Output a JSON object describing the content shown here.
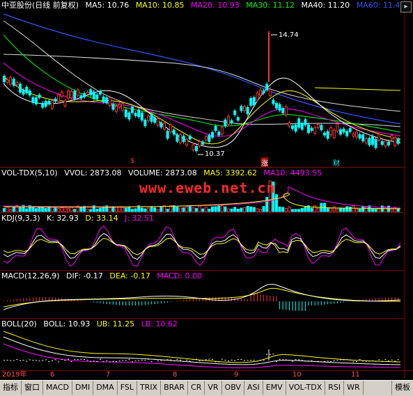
{
  "main": {
    "title": "中亚股份(日线 前复权)",
    "ma": [
      {
        "text": "MA5: 10.76",
        "color": "#ffffff"
      },
      {
        "text": "MA10: 10.85",
        "color": "#ffff00"
      },
      {
        "text": "MA20: 10.93",
        "color": "#ff00ff"
      },
      {
        "text": "MA30: 11.12",
        "color": "#00ff00"
      },
      {
        "text": "MA40: 11.20",
        "color": "#ffffff"
      },
      {
        "text": "MA60: 11.4",
        "color": "#3355ff"
      }
    ],
    "high_label": "14.74",
    "low_label": "10.37",
    "markers": [
      "$",
      "涨",
      "财"
    ]
  },
  "vol": {
    "name": "VOL-TDX(5,10)",
    "items": [
      {
        "text": "VVOL: 2873.08",
        "color": "#ffffff"
      },
      {
        "text": "VOLUME: 2873.08",
        "color": "#ffffff"
      },
      {
        "text": "MA5: 3392.62",
        "color": "#ffff00"
      },
      {
        "text": "MA10: 4493.55",
        "color": "#ff00ff"
      }
    ]
  },
  "kdj": {
    "name": "KDJ(9,3,3)",
    "items": [
      {
        "text": "K: 32.93",
        "color": "#ffffff"
      },
      {
        "text": "D: 33.14",
        "color": "#ffff00"
      },
      {
        "text": "J: 32.51",
        "color": "#ff00ff"
      }
    ]
  },
  "macd": {
    "name": "MACD(12,26,9)",
    "items": [
      {
        "text": "DIF: -0.17",
        "color": "#ffffff"
      },
      {
        "text": "DEA: -0.17",
        "color": "#ffff00"
      },
      {
        "text": "MACD: 0.00",
        "color": "#ff00ff"
      }
    ]
  },
  "boll": {
    "name": "BOLL(20)",
    "items": [
      {
        "text": "BOLL: 10.93",
        "color": "#ffffff"
      },
      {
        "text": "UB: 11.25",
        "color": "#ffff00"
      },
      {
        "text": "LB: 10.62",
        "color": "#ff00ff"
      }
    ]
  },
  "watermark": "www.eweb.net.cn",
  "xaxis": [
    "2019年",
    "6",
    "7",
    "8",
    "9",
    "10",
    "11"
  ],
  "tabs": [
    "指标",
    "窗口",
    "MACD",
    "DMI",
    "DMA",
    "FSL",
    "TRIX",
    "BRAR",
    "CR",
    "VR",
    "OBV",
    "ASI",
    "EMV",
    "VOL-TDX",
    "RSI",
    "WR",
    "模板"
  ],
  "scroll_button": "▸",
  "colors": {
    "up": "#ff3232",
    "down": "#00ffff",
    "grid": "#7a0000"
  }
}
